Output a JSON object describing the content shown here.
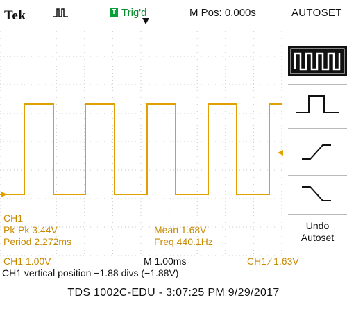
{
  "header": {
    "brand": "Tek",
    "acquire_icon": "pulse-acquire-icon",
    "trigger_badge": "T",
    "trigger_status": "Trig'd",
    "main_position": "M Pos: 0.000s",
    "menu_title": "AUTOSET"
  },
  "display": {
    "ch1_label": "CH1",
    "pk_pk": "Pk-Pk 3.44V",
    "period": "Period 2.272ms",
    "mean": "Mean 1.68V",
    "freq": "Freq 440.1Hz",
    "ch1_marker": "1",
    "trace_color": "#e0a000",
    "grid_color": "#c8c8c8"
  },
  "menu": {
    "items": [
      {
        "icon": "square-wave-icon",
        "selected": true
      },
      {
        "icon": "single-pulse-icon",
        "selected": false
      },
      {
        "icon": "rising-edge-icon",
        "selected": false
      },
      {
        "icon": "falling-edge-icon",
        "selected": false
      }
    ],
    "undo_line1": "Undo",
    "undo_line2": "Autoset"
  },
  "status": {
    "ch1_scale": "CH1  1.00V",
    "time_scale": "M 1.00ms",
    "trigger_level": "CH1  ⁄  1.63V",
    "vertical_position": "CH1 vertical position −1.88 divs (−1.88V)"
  },
  "caption": "TDS 1002C-EDU - 3:07:25 PM   9/29/2017"
}
